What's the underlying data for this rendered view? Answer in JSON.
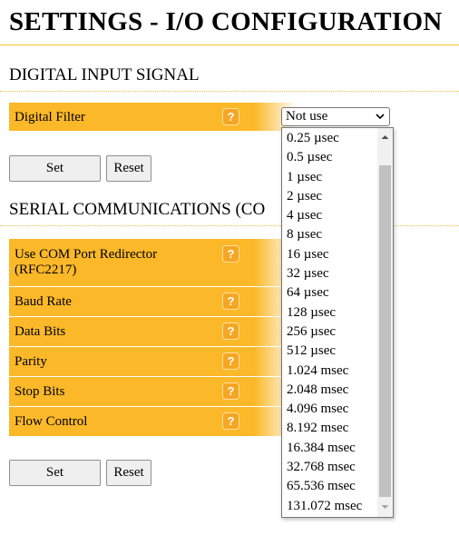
{
  "page": {
    "title": "SETTINGS - I/O CONFIGURATION"
  },
  "digital_input": {
    "heading": "DIGITAL INPUT SIGNAL",
    "filter_label": "Digital Filter",
    "help_glyph": "?",
    "filter_value": "Not use",
    "set_label": "Set",
    "reset_label": "Reset"
  },
  "serial": {
    "heading": "SERIAL COMMUNICATIONS (CO",
    "rows": [
      {
        "label": "Use COM Port Redirector (RFC2217)",
        "help": "?"
      },
      {
        "label": "Baud Rate",
        "help": "?"
      },
      {
        "label": "Data Bits",
        "help": "?"
      },
      {
        "label": "Parity",
        "help": "?"
      },
      {
        "label": "Stop Bits",
        "help": "?"
      },
      {
        "label": "Flow Control",
        "help": "?"
      }
    ],
    "set_label": "Set",
    "reset_label": "Reset"
  },
  "filter_options": [
    "0.25 µsec",
    "0.5 µsec",
    "1 µsec",
    "2 µsec",
    "4 µsec",
    "8 µsec",
    "16 µsec",
    "32 µsec",
    "64 µsec",
    "128 µsec",
    "256 µsec",
    "512 µsec",
    "1.024 msec",
    "2.048 msec",
    "4.096 msec",
    "8.192 msec",
    "16.384 msec",
    "32.768 msec",
    "65.536 msec",
    "131.072 msec"
  ],
  "colors": {
    "label_bg": "#fbb828",
    "help_bg": "#f5a623",
    "rule": "#f4c22b"
  }
}
